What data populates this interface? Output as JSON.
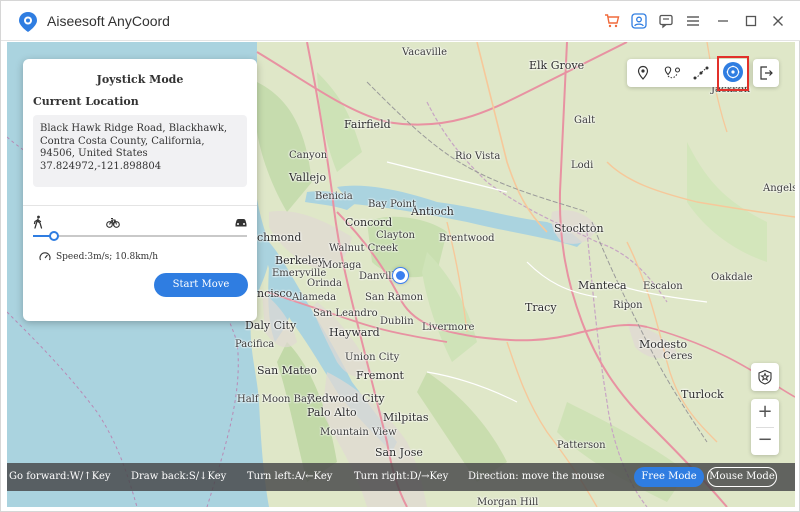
{
  "app": {
    "title": "Aiseesoft AnyCoord"
  },
  "titlebar": {
    "icons": [
      "cart-icon",
      "user-icon",
      "feedback-icon",
      "menu-icon",
      "minimize-icon",
      "maximize-icon",
      "close-icon"
    ]
  },
  "panel": {
    "title": "Joystick Mode",
    "current_location_label": "Current Location",
    "address_line": "Black Hawk Ridge Road, Blackhawk, Contra Costa County, California, 94506, United States",
    "coordinates": "37.824972,-121.898804",
    "speed_text": "Speed:3m/s; 10.8km/h",
    "speed_level": 0.1,
    "start_button": "Start Move",
    "modes": [
      "walk-icon",
      "bike-icon",
      "car-icon"
    ]
  },
  "map": {
    "labels": {
      "vacaville": "Vacaville",
      "elk_grove": "Elk Grove",
      "fairfield": "Fairfield",
      "galt": "Galt",
      "rio_vista": "Rio Vista",
      "lodi": "Lodi",
      "canyon": "Canyon",
      "vallejo": "Vallejo",
      "benicia": "Benicia",
      "antioch": "Antioch",
      "concord": "Concord",
      "bay_point": "Bay Point",
      "brentwood": "Brentwood",
      "stockton": "Stockton",
      "richmond": "chmond",
      "walnut_creek": "Walnut Creek",
      "clayton": "Clayton",
      "berkeley": "Berkeley",
      "emeryville": "Emeryville",
      "moraga": "Moraga",
      "orinda": "Orinda",
      "danville": "Danville",
      "san_ramon": "San Ramon",
      "sf": "ncisco",
      "alameda": "Alameda",
      "tracy": "Tracy",
      "manteca": "Manteca",
      "ripon": "Ripon",
      "escalon": "Escalon",
      "oakdale": "Oakdale",
      "angels_camp": "Angels Ca",
      "daly_city": "Daly City",
      "hayward": "Hayward",
      "dublin": "Dublin",
      "livermore": "Livermore",
      "san_leandro": "San Leandro",
      "pacifica": "Pacifica",
      "san_mateo": "San Mateo",
      "fremont": "Fremont",
      "union_city": "Union City",
      "modesto": "Modesto",
      "ceres": "Ceres",
      "redwood_city": "Redwood City",
      "palo_alto": "Palo Alto",
      "milpitas": "Milpitas",
      "mountain_view": "Mountain View",
      "turlock": "Turlock",
      "san_jose": "San Jose",
      "half_moon_bay": "Half Moon Bay",
      "patterson": "Patterson",
      "jackson": "Jackson",
      "morgan_hill": "Morgan Hill"
    }
  },
  "bottombar": {
    "forward": "Go forward:W/↑Key",
    "back": "Draw back:S/↓Key",
    "left": "Turn left:A/←Key",
    "right": "Turn right:D/→Key",
    "direction": "Direction: move the mouse",
    "free_mode": "Free Mode",
    "mouse_mode": "Mouse Mode"
  },
  "colors": {
    "accent": "#2f7de1",
    "highlight": "#e2302a"
  }
}
